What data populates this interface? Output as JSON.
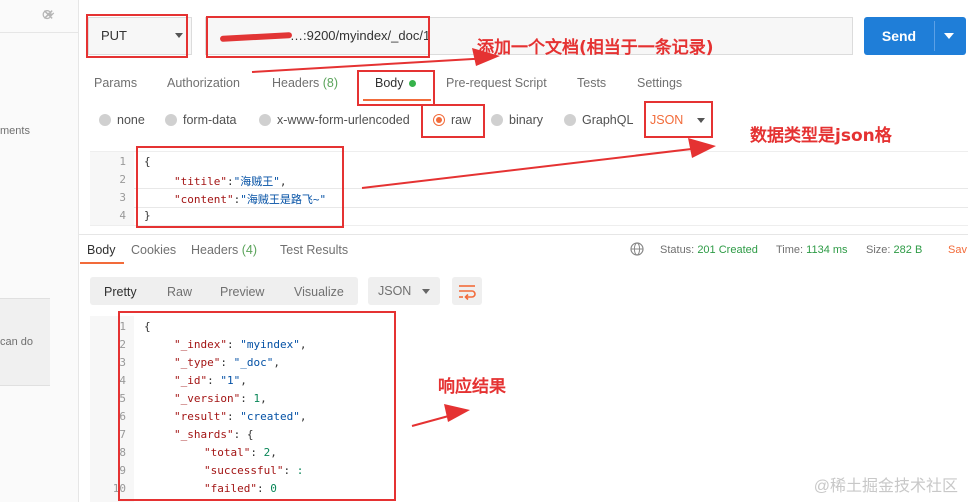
{
  "sidebar": {
    "snippets": [
      "ments",
      "can do"
    ]
  },
  "request": {
    "method": "PUT",
    "url": "…:9200/myindex/_doc/1",
    "send_label": "Send"
  },
  "tabs": [
    {
      "label": "Params"
    },
    {
      "label": "Authorization"
    },
    {
      "label": "Headers",
      "count": "(8)"
    },
    {
      "label": "Body"
    },
    {
      "label": "Pre-request Script"
    },
    {
      "label": "Tests"
    },
    {
      "label": "Settings"
    }
  ],
  "body_types": [
    "none",
    "form-data",
    "x-www-form-urlencoded",
    "raw",
    "binary",
    "GraphQL"
  ],
  "body_format": "JSON",
  "request_body": {
    "line_numbers": [
      "1",
      "2",
      "3",
      "4"
    ],
    "open": "{",
    "k1": "\"titile\"",
    "v1": "\"海贼王\"",
    "k2": "\"content\"",
    "v2": "\"海贼王是路飞~\"",
    "close": "}"
  },
  "response_tabs": [
    {
      "label": "Body"
    },
    {
      "label": "Cookies"
    },
    {
      "label": "Headers",
      "count": "(4)"
    },
    {
      "label": "Test Results"
    }
  ],
  "response_meta": {
    "status_label": "Status:",
    "status": "201 Created",
    "time_label": "Time:",
    "time": "1134 ms",
    "size_label": "Size:",
    "size": "282 B",
    "save": "Sav"
  },
  "views": [
    "Pretty",
    "Raw",
    "Preview",
    "Visualize"
  ],
  "response_format": "JSON",
  "response_body": {
    "line_numbers": [
      "1",
      "2",
      "3",
      "4",
      "5",
      "6",
      "7",
      "8",
      "9",
      "10"
    ],
    "open": "{",
    "index_k": "\"_index\"",
    "index_v": "\"myindex\"",
    "type_k": "\"_type\"",
    "type_v": "\"_doc\"",
    "id_k": "\"_id\"",
    "id_v": "\"1\"",
    "version_k": "\"_version\"",
    "version_v": "1",
    "result_k": "\"result\"",
    "result_v": "\"created\"",
    "shards_k": "\"_shards\"",
    "shards_v": "{",
    "total_k": "\"total\"",
    "total_v": "2",
    "successful_k": "\"successful\"",
    "successful_v": ":",
    "failed_k": "\"failed\"",
    "failed_v": "0"
  },
  "annotations": {
    "note1": "添加一个文档(相当于一条记录)",
    "note2": "数据类型是json格",
    "note3": "响应结果"
  },
  "watermark": "@稀土掘金技术社区",
  "colors": {
    "accent": "#f26b3a",
    "send": "#1f7ed8",
    "annotation": "#e53232",
    "status_ok": "#2e9b46"
  }
}
